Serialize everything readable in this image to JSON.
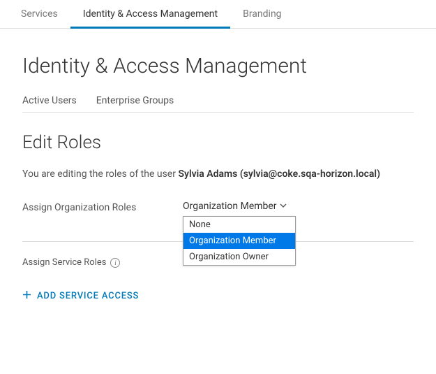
{
  "tabs": {
    "items": [
      {
        "label": "Services",
        "active": false
      },
      {
        "label": "Identity & Access Management",
        "active": true
      },
      {
        "label": "Branding",
        "active": false
      }
    ]
  },
  "page": {
    "title": "Identity & Access Management"
  },
  "sub_tabs": {
    "items": [
      {
        "label": "Active Users"
      },
      {
        "label": "Enterprise Groups"
      }
    ]
  },
  "section": {
    "title": "Edit Roles",
    "desc_prefix": "You are editing the roles of the user ",
    "user_display": "Sylvia Adams (sylvia@coke.sqa-horizon.local)"
  },
  "org_roles": {
    "label": "Assign Organization Roles",
    "selected": "Organization Member",
    "options": [
      "None",
      "Organization Member",
      "Organization Owner"
    ]
  },
  "service_roles": {
    "label": "Assign Service Roles"
  },
  "add_service": {
    "label": "ADD SERVICE ACCESS"
  }
}
